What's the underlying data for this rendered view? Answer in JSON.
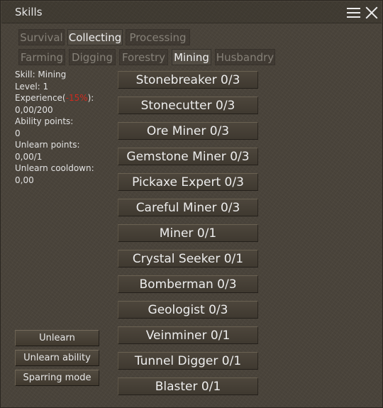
{
  "window": {
    "title": "Skills"
  },
  "tabs": {
    "categories": [
      "Survival",
      "Collecting",
      "Processing"
    ],
    "active_category": "Collecting",
    "skills": [
      "Farming",
      "Digging",
      "Forestry",
      "Mining",
      "Husbandry"
    ],
    "active_skill": "Mining"
  },
  "info": {
    "skill": "Skill: Mining",
    "level": "Level: 1",
    "experience_prefix": "Experience(",
    "experience_penalty": "-15%",
    "experience_suffix": "):",
    "experience_value": "0,00/200",
    "ability_points_label": "Ability points:",
    "ability_points_value": "0",
    "unlearn_points_label": "Unlearn points:",
    "unlearn_points_value": "0,00/1",
    "unlearn_cooldown_label": "Unlearn cooldown:",
    "unlearn_cooldown_value": "0,00"
  },
  "abilities": [
    "Stonebreaker 0/3",
    "Stonecutter 0/3",
    "Ore Miner 0/3",
    "Gemstone Miner 0/3",
    "Pickaxe Expert 0/3",
    "Careful Miner 0/3",
    "Miner 0/1",
    "Crystal Seeker 0/1",
    "Bomberman 0/3",
    "Geologist 0/3",
    "Veinminer 0/1",
    "Tunnel Digger 0/1",
    "Blaster 0/1"
  ],
  "buttons": {
    "unlearn": "Unlearn",
    "unlearn_ability": "Unlearn ability",
    "sparring_mode": "Sparring mode"
  },
  "colors": {
    "background": "#4a443b",
    "text": "#d9d9d9",
    "penalty": "#d02a1e"
  },
  "icons": {
    "menu": "hamburger-menu-icon",
    "close": "close-icon"
  }
}
